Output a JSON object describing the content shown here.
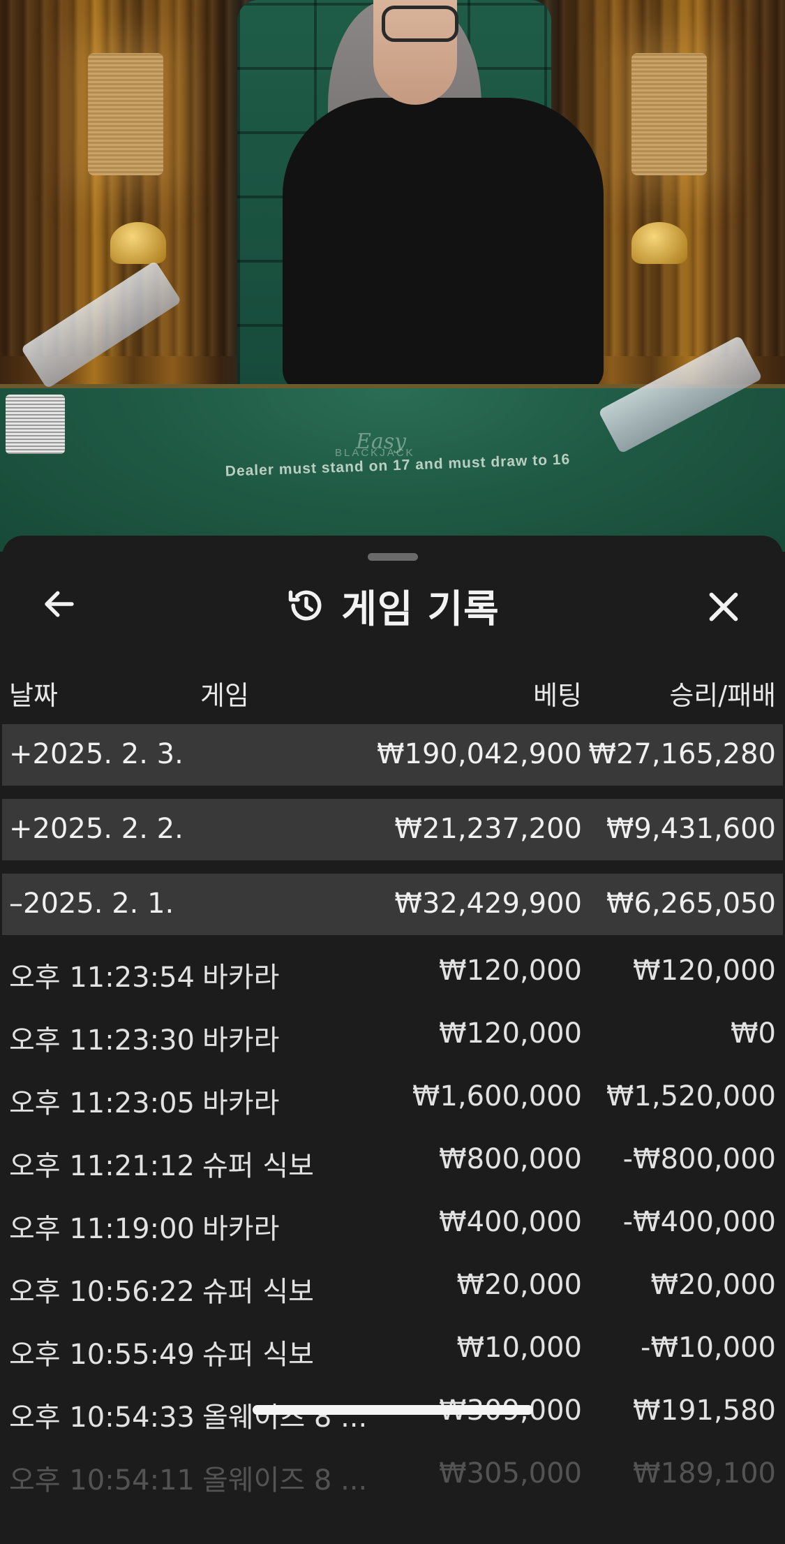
{
  "video": {
    "table_logo_script": "Easy",
    "table_logo_name": "BLACKJACK",
    "table_rule": "Dealer must stand on 17 and must draw to 16"
  },
  "header": {
    "title": "게임 기록",
    "back_icon": "arrow-left-icon",
    "history_icon": "history-clock-icon",
    "close_icon": "close-x-icon"
  },
  "columns": {
    "date": "날짜",
    "game": "게임",
    "bet": "베팅",
    "win_loss": "승리/패배"
  },
  "days": [
    {
      "date": "+2025. 2. 3.",
      "bet": "₩190,042,900",
      "win": "₩27,165,280"
    },
    {
      "date": "+2025. 2. 2.",
      "bet": "₩21,237,200",
      "win": "₩9,431,600"
    },
    {
      "date": "–2025. 2. 1.",
      "bet": "₩32,429,900",
      "win": "₩6,265,050"
    }
  ],
  "transactions": [
    {
      "time": "오후 11:23:54",
      "game": "바카라",
      "bet": "₩120,000",
      "win": "₩120,000"
    },
    {
      "time": "오후 11:23:30",
      "game": "바카라",
      "bet": "₩120,000",
      "win": "₩0"
    },
    {
      "time": "오후 11:23:05",
      "game": "바카라",
      "bet": "₩1,600,000",
      "win": "₩1,520,000"
    },
    {
      "time": "오후 11:21:12",
      "game": "슈퍼 식보",
      "bet": "₩800,000",
      "win": "-₩800,000"
    },
    {
      "time": "오후 11:19:00",
      "game": "바카라",
      "bet": "₩400,000",
      "win": "-₩400,000"
    },
    {
      "time": "오후 10:56:22",
      "game": "슈퍼 식보",
      "bet": "₩20,000",
      "win": "₩20,000"
    },
    {
      "time": "오후 10:55:49",
      "game": "슈퍼 식보",
      "bet": "₩10,000",
      "win": "-₩10,000"
    },
    {
      "time": "오후 10:54:33",
      "game": "올웨이즈 8 ...",
      "bet": "₩309,000",
      "win": "₩191,580"
    },
    {
      "time": "오후 10:54:11",
      "game": "올웨이즈 8 ...",
      "bet": "₩305,000",
      "win": "₩189,100"
    }
  ],
  "colors": {
    "sheet_bg": "#1c1c1c",
    "day_row_bg": "#393939",
    "text": "#e8e8e8"
  }
}
